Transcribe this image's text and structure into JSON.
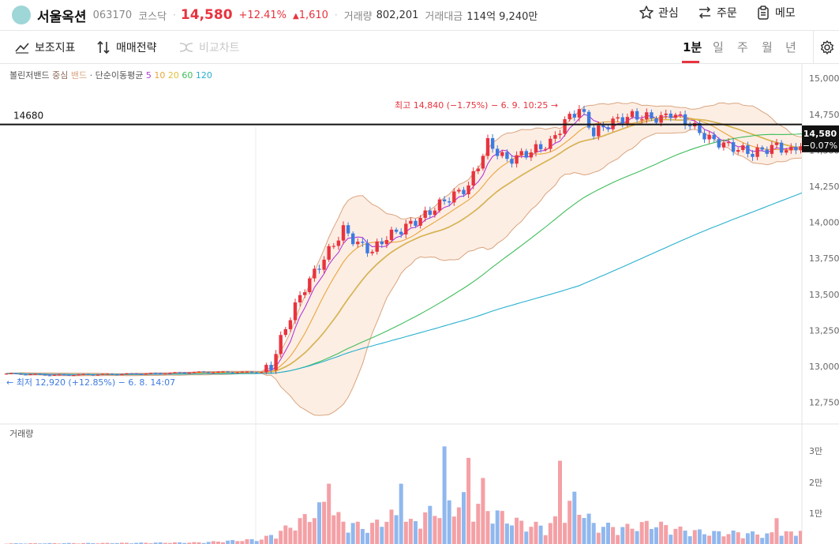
{
  "header": {
    "name": "서울옥션",
    "code": "063170",
    "market": "코스닥",
    "price": "14,580",
    "change_pct": "+12.41%",
    "change_abs": "1,610",
    "volume_label": "거래량",
    "volume": "802,201",
    "amount_label": "거래대금",
    "amount": "114억 9,240만",
    "watch_label": "관심",
    "order_label": "주문",
    "memo_label": "메모"
  },
  "toolbar": {
    "indicator_label": "보조지표",
    "strategy_label": "매매전략",
    "compare_label": "비교차트",
    "timeframes": [
      "1분",
      "일",
      "주",
      "월",
      "년"
    ],
    "active_timeframe": "1분"
  },
  "legend": {
    "bb_label": "볼린저밴드",
    "bb_center": "중심",
    "bb_band": "밴드",
    "sma_label": "· 단순이동평균",
    "ma_periods": [
      "5",
      "10",
      "20",
      "60",
      "120"
    ],
    "ma_colors": [
      "#b03ad6",
      "#e8a63b",
      "#e0c23a",
      "#3fbd5a",
      "#27b0cf"
    ]
  },
  "annotations": {
    "high": "최고 14,840 (−1.75%) − 6. 9. 10:25 →",
    "low": "← 최저 12,920 (+12.85%) − 6. 8. 14:07",
    "hline_label": "14680",
    "price_tag": "14,580",
    "price_tag_pct": "−0.07%"
  },
  "volume_panel": {
    "title": "거래량",
    "ticks": [
      "3만",
      "2만",
      "1만"
    ]
  },
  "colors": {
    "up": "#e8333e",
    "down": "#3d7be0",
    "vol_up": "#f4a0a5",
    "vol_down": "#90b8ee",
    "bb_fill": "#fdeee4",
    "bb_line": "#d9a47e",
    "bb_mid": "#b58a72"
  },
  "chart_data": {
    "type": "candlestick",
    "y_ticks": [
      15000,
      14750,
      14500,
      14250,
      14000,
      13750,
      13500,
      13250,
      13000,
      12750
    ],
    "ylim": [
      12600,
      15100
    ],
    "hline": 14680,
    "last_price": 14580,
    "high": 14840,
    "low": 12920,
    "volume_ylim": [
      0,
      33000
    ],
    "price_path": [
      [
        0,
        12950
      ],
      [
        10,
        12940
      ],
      [
        20,
        12945
      ],
      [
        30,
        12950
      ],
      [
        40,
        12960
      ],
      [
        53,
        12960
      ],
      [
        55,
        13000
      ],
      [
        56,
        13100
      ],
      [
        59,
        13350
      ],
      [
        62,
        13550
      ],
      [
        66,
        13750
      ],
      [
        70,
        13950
      ],
      [
        73,
        13850
      ],
      [
        76,
        13800
      ],
      [
        79,
        13900
      ],
      [
        82,
        13950
      ],
      [
        87,
        14050
      ],
      [
        91,
        14150
      ],
      [
        96,
        14250
      ],
      [
        100,
        14550
      ],
      [
        104,
        14430
      ],
      [
        108,
        14480
      ],
      [
        113,
        14550
      ],
      [
        116,
        14700
      ],
      [
        119,
        14790
      ],
      [
        122,
        14620
      ],
      [
        126,
        14700
      ],
      [
        130,
        14740
      ],
      [
        136,
        14720
      ],
      [
        138,
        14760
      ],
      [
        142,
        14680
      ],
      [
        146,
        14580
      ],
      [
        150,
        14530
      ],
      [
        155,
        14480
      ],
      [
        160,
        14530
      ],
      [
        163,
        14490
      ],
      [
        166,
        14580
      ]
    ],
    "volume_path": [
      [
        0,
        200
      ],
      [
        20,
        300
      ],
      [
        40,
        500
      ],
      [
        53,
        1500
      ],
      [
        57,
        4000
      ],
      [
        62,
        8000
      ],
      [
        66,
        12000
      ],
      [
        70,
        7000
      ],
      [
        75,
        5000
      ],
      [
        80,
        9000
      ],
      [
        84,
        6500
      ],
      [
        88,
        10000
      ],
      [
        92,
        12000
      ],
      [
        96,
        14000
      ],
      [
        100,
        11000
      ],
      [
        104,
        8000
      ],
      [
        108,
        6000
      ],
      [
        112,
        5500
      ],
      [
        115,
        8000
      ],
      [
        118,
        14000
      ],
      [
        122,
        6000
      ],
      [
        128,
        5000
      ],
      [
        134,
        6500
      ],
      [
        140,
        4500
      ],
      [
        146,
        3500
      ],
      [
        152,
        3500
      ],
      [
        158,
        3000
      ],
      [
        163,
        3500
      ],
      [
        166,
        5000
      ]
    ],
    "volume_spikes": [
      [
        67,
        21000
      ],
      [
        82,
        21000
      ],
      [
        91,
        34000
      ],
      [
        96,
        30000
      ],
      [
        99,
        23000
      ],
      [
        115,
        29000
      ],
      [
        160,
        9000
      ]
    ]
  }
}
